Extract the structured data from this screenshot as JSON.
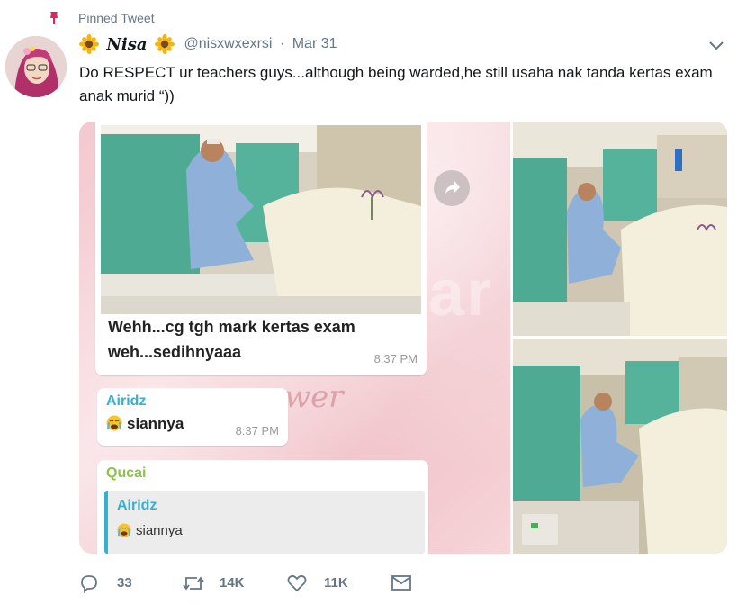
{
  "pinned": {
    "label": "Pinned Tweet",
    "icon": "pin-icon"
  },
  "author": {
    "display_name": "𝑵𝒊𝒔𝒂",
    "name_emoji": "sunflower-icon",
    "handle": "@nisxwxexrsi",
    "separator": "·",
    "date": "Mar 31"
  },
  "tweet": {
    "text": "Do RESPECT ur teachers guys...although being warded,he still usaha nak tanda kertas exam anak murid “))"
  },
  "media": {
    "chat": {
      "photo_caption": "Wehh...cg tgh mark kertas exam weh...sedihnyaaa",
      "photo_time": "8:37 PM",
      "msg2_sender": "Airidz",
      "msg2_text": "siannya",
      "msg2_time": "8:37 PM",
      "msg3_sender": "Qucai",
      "quote_sender": "Airidz",
      "quote_text": "siannya",
      "watermark": "xStar",
      "script_watermark": "wer"
    },
    "colors": {
      "sender_blue": "#35b0cf",
      "sender_green": "#8cc34a",
      "chat_bg_pink": "#f3c9cf"
    }
  },
  "actions": {
    "reply": {
      "icon": "reply-icon",
      "count": "33"
    },
    "retweet": {
      "icon": "retweet-icon",
      "count": "14K"
    },
    "like": {
      "icon": "heart-icon",
      "count": "11K"
    },
    "dm": {
      "icon": "direct-message-icon"
    }
  }
}
